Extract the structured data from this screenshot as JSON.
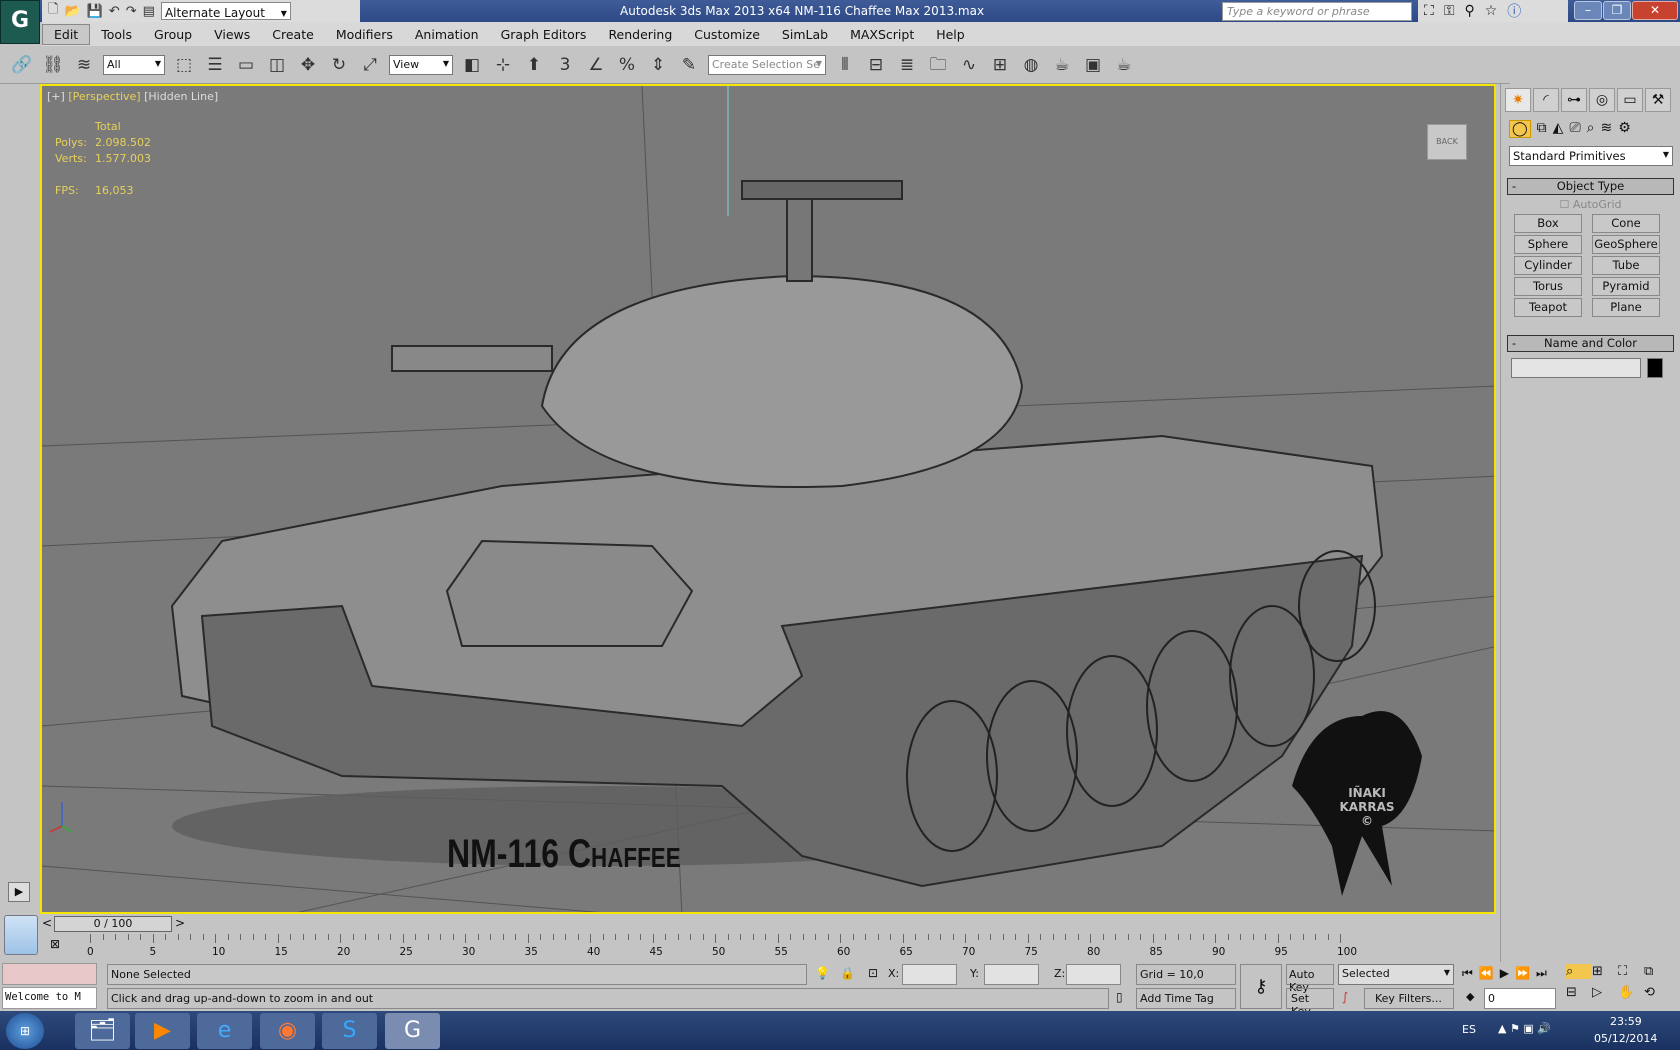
{
  "app": {
    "title": "Autodesk 3ds Max  2013 x64     NM-116  Chaffee Max 2013.max",
    "logo": "3ds Max logo"
  },
  "quick_access": {
    "layout": "Alternate Layout"
  },
  "search": {
    "placeholder": "Type a keyword or phrase"
  },
  "menu": [
    "Edit",
    "Tools",
    "Group",
    "Views",
    "Create",
    "Modifiers",
    "Animation",
    "Graph Editors",
    "Rendering",
    "Customize",
    "SimLab",
    "MAXScript",
    "Help"
  ],
  "toolbar": {
    "selection_filter": "All",
    "ref_coord": "View",
    "snap_3": "3",
    "snap_pct": "%",
    "selection_set_placeholder": "Create Selection Se"
  },
  "viewport": {
    "label_plus": "[+]",
    "label_view": "[Perspective]",
    "label_shading": "[Hidden Line]",
    "stats_header": "Total",
    "polys_label": "Polys:",
    "polys": "2.098.502",
    "verts_label": "Verts:",
    "verts": "1.577.003",
    "fps_label": "FPS:",
    "fps": "16,053",
    "caption": "NM-116 Chaffee",
    "watermark": "IÑAKI KARRAS ©",
    "viewcube": "BACK",
    "border_color": "#f5e400",
    "text_color": "#e6d25a"
  },
  "command_panel": {
    "category": "Standard Primitives",
    "object_type_title": "Object Type",
    "autogrid": "AutoGrid",
    "buttons": [
      "Box",
      "Cone",
      "Sphere",
      "GeoSphere",
      "Cylinder",
      "Tube",
      "Torus",
      "Pyramid",
      "Teapot",
      "Plane"
    ],
    "name_color_title": "Name and Color",
    "object_color": "#000000"
  },
  "timeline": {
    "frame": "0 / 100",
    "ticks": [
      "0",
      "5",
      "10",
      "15",
      "20",
      "25",
      "30",
      "35",
      "40",
      "45",
      "50",
      "55",
      "60",
      "65",
      "70",
      "75",
      "80",
      "85",
      "90",
      "95",
      "100"
    ]
  },
  "status": {
    "selection": "None Selected",
    "prompt": "Click and drag up-and-down to zoom in and out",
    "listener": "Welcome to M",
    "x_label": "X:",
    "y_label": "Y:",
    "z_label": "Z:",
    "grid": "Grid = 10,0",
    "add_time_tag": "Add Time Tag",
    "auto_key": "Auto Key",
    "set_key": "Set Key",
    "key_mode": "Selected",
    "key_filters": "Key Filters...",
    "current_frame": "0"
  },
  "taskbar": {
    "lang": "ES",
    "time": "23:59",
    "date": "05/12/2014"
  }
}
